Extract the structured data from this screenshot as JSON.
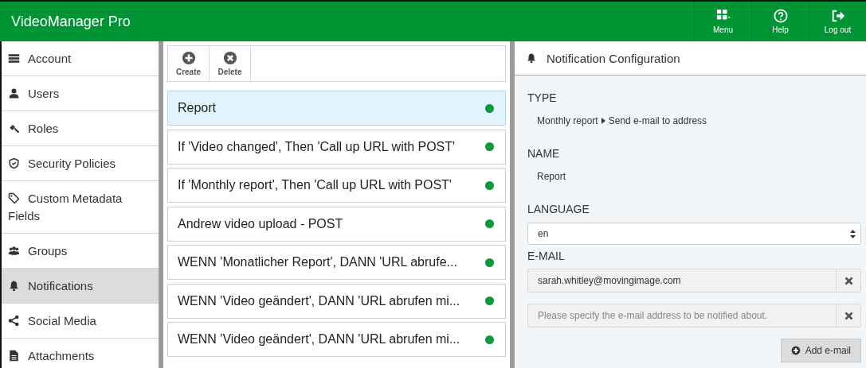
{
  "app": {
    "title": "VideoManager Pro",
    "actions": [
      {
        "label": "Menu"
      },
      {
        "label": "Help"
      },
      {
        "label": "Log out"
      }
    ]
  },
  "sidebar": {
    "items": [
      {
        "label": "Account",
        "selected": false
      },
      {
        "label": "Users",
        "selected": false
      },
      {
        "label": "Roles",
        "selected": false
      },
      {
        "label": "Security Policies",
        "selected": false
      },
      {
        "label": "Custom Metadata Fields",
        "selected": false
      },
      {
        "label": "Groups",
        "selected": false
      },
      {
        "label": "Notifications",
        "selected": true
      },
      {
        "label": "Social Media",
        "selected": false
      },
      {
        "label": "Attachments",
        "selected": false
      }
    ]
  },
  "toolbar": [
    {
      "label": "Create"
    },
    {
      "label": "Delete"
    }
  ],
  "notifications": [
    {
      "name": "Report",
      "active": true,
      "selected": true
    },
    {
      "name": "If 'Video changed', Then 'Call up URL with POST'",
      "active": true,
      "selected": false
    },
    {
      "name": "If 'Monthly report', Then 'Call up URL with POST'",
      "active": true,
      "selected": false
    },
    {
      "name": "Andrew video upload - POST",
      "active": true,
      "selected": false
    },
    {
      "name": "WENN 'Monatlicher Report', DANN 'URL abrufe...",
      "active": true,
      "selected": false
    },
    {
      "name": "WENN 'Video geändert', DANN 'URL abrufen mi...",
      "active": true,
      "selected": false
    },
    {
      "name": "WENN 'Video geändert', DANN 'URL abrufen mi...",
      "active": true,
      "selected": false
    }
  ],
  "config": {
    "title": "Notification Configuration",
    "type_label": "TYPE",
    "type_trigger": "Monthly report",
    "type_action": "Send e-mail to address",
    "name_label": "NAME",
    "name_value": "Report",
    "language_label": "LANGUAGE",
    "language_value": "en",
    "email_label": "E-MAIL",
    "emails": [
      {
        "value": "sarah.whitley@movingimage.com"
      },
      {
        "placeholder": "Please specify the e-mail address to be notified about."
      }
    ],
    "add_button": "Add e-mail"
  }
}
